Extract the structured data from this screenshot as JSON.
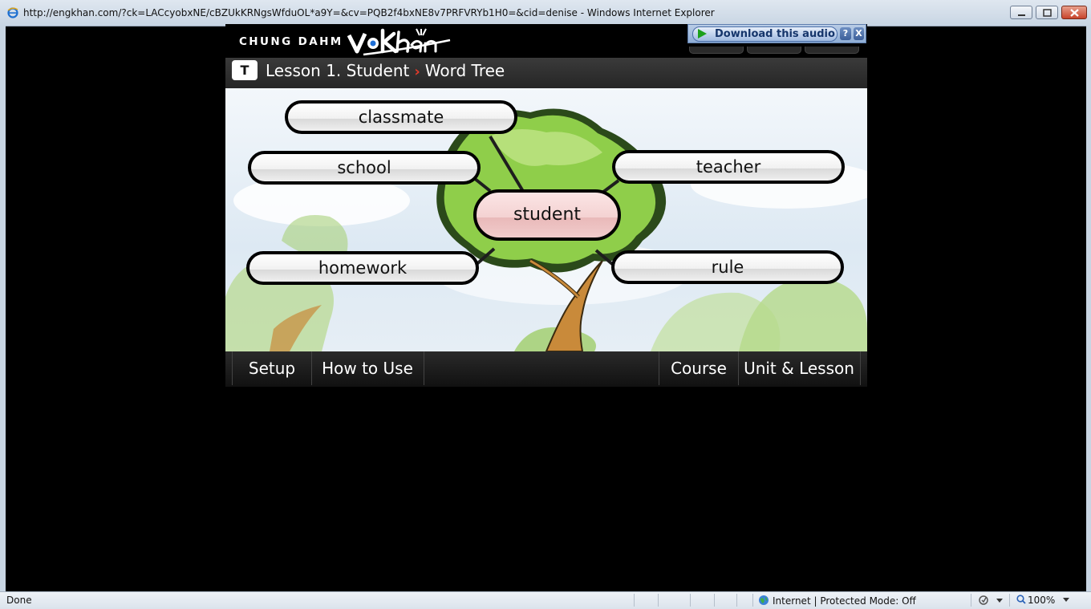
{
  "window": {
    "title": "http://engkhan.com/?ck=LACcyobxNE/cBZUkKRNgsWfduOL*a9Y=&cv=PQB2f4bxNE8v7PRFVRYb1H0=&cid=denise  - Windows Internet Explorer",
    "icon": "ie-icon"
  },
  "header": {
    "brand": "CHUNG DAHM",
    "logo": "vokhan-logo"
  },
  "download": {
    "label": "Download this audio",
    "help": "?",
    "close": "X"
  },
  "lesson": {
    "badge": "T",
    "title": "Lesson 1. Student",
    "separator": "›",
    "section": "Word Tree"
  },
  "word_tree": {
    "center": "student",
    "words": [
      "classmate",
      "school",
      "teacher",
      "homework",
      "rule"
    ]
  },
  "menu": {
    "setup": "Setup",
    "how_to_use": "How to Use",
    "course": "Course",
    "unit_lesson": "Unit & Lesson"
  },
  "status": {
    "left": "Done",
    "zone": "Internet | Protected Mode: Off",
    "zoom": "100%"
  },
  "colors": {
    "accent_red": "#e03a2a",
    "center_node": "#f4d2d2",
    "tree_green": "#8fce4a"
  }
}
